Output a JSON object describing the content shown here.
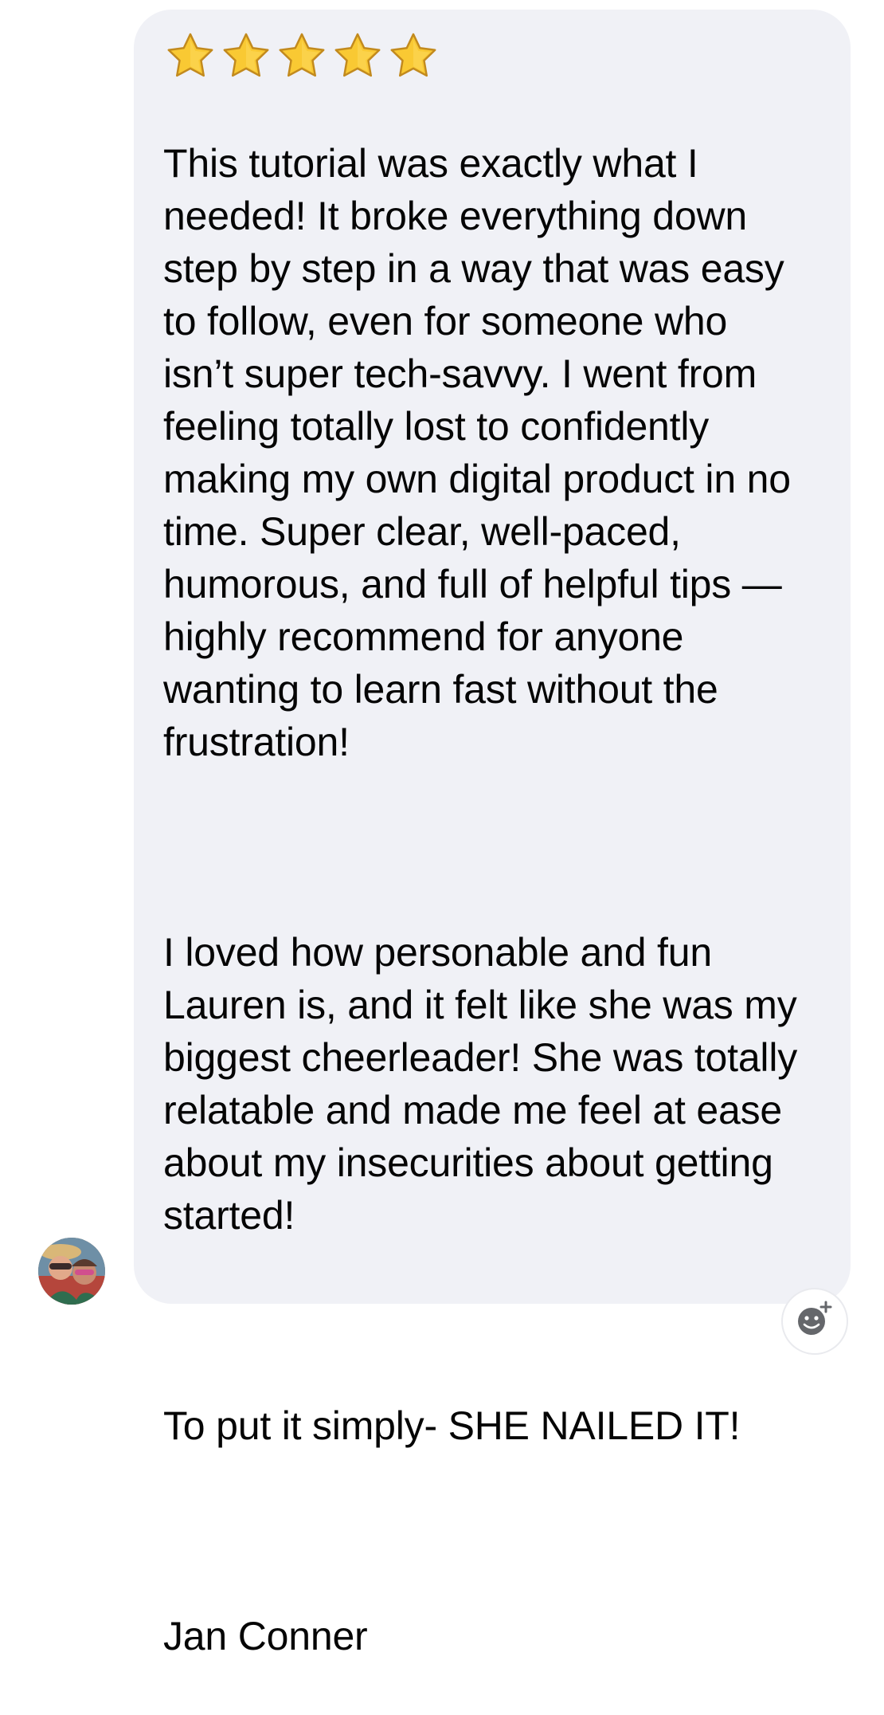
{
  "review": {
    "rating": 5,
    "rating_max": 5,
    "star_color": "#f7c531",
    "paragraphs": [
      "This tutorial was exactly what I\nneeded! It broke everything down\nstep by step in a way that was easy\nto follow, even for someone who\nisn’t super tech-savvy. I went from\nfeeling totally lost to confidently\nmaking my own digital product in no\ntime. Super clear, well-paced,\nhumorous, and full of helpful tips —\nhighly recommend for anyone\nwanting to learn fast without the\nfrustration!",
      "I loved how personable and fun\nLauren is, and it felt like she was my\nbiggest cheerleader! She was totally\nrelatable and made me feel at ease\nabout my insecurities about getting\nstarted!",
      "To put it simply- SHE NAILED IT!",
      "Jan Conner"
    ]
  },
  "sender": {
    "avatar_icon": "profile-photo"
  },
  "actions": {
    "add_reaction_icon": "add-reaction-icon"
  },
  "colors": {
    "bubble_bg": "#f0f1f6",
    "text": "#050505"
  }
}
